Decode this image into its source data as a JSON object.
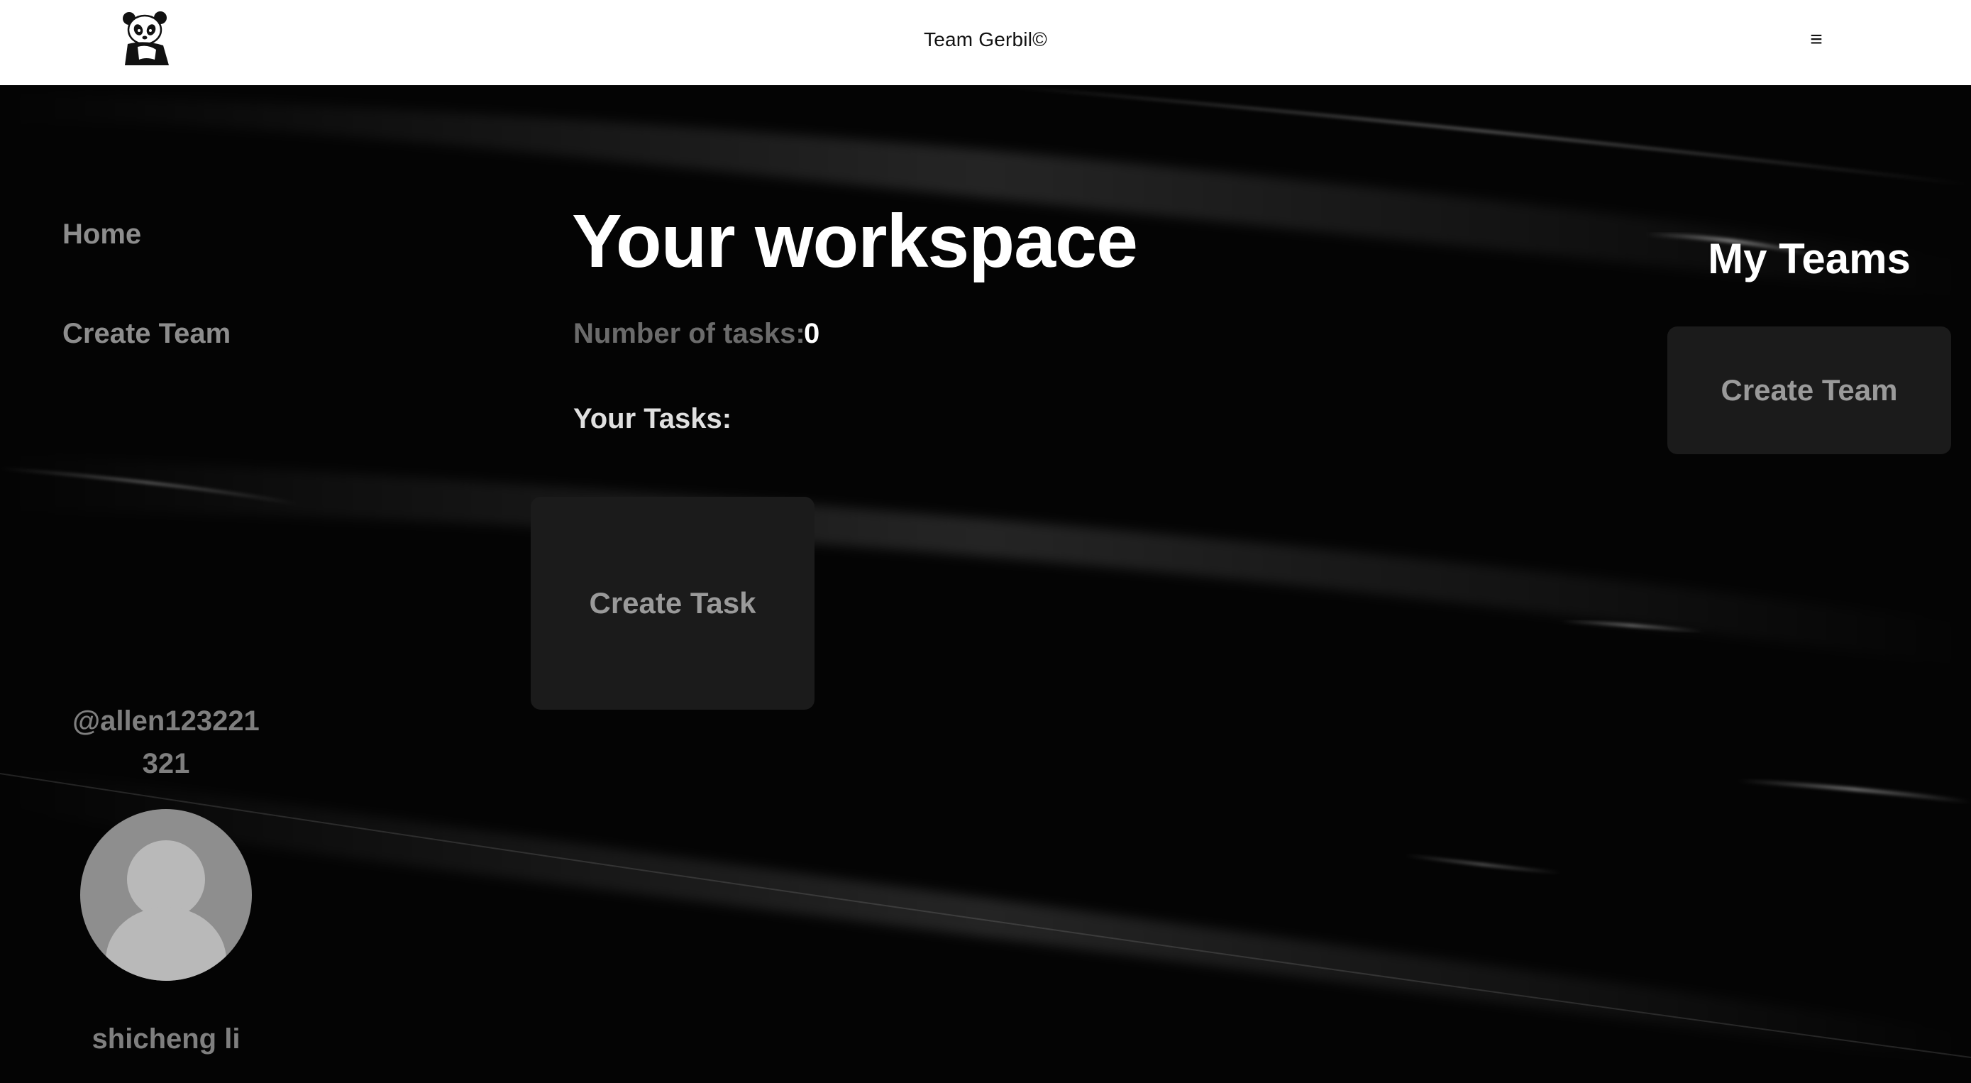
{
  "header": {
    "title": "Team Gerbil©",
    "logo_icon": "panda-logo-icon",
    "menu_icon": "≡"
  },
  "sidebar": {
    "items": [
      {
        "label": "Home"
      },
      {
        "label": "Create Team"
      }
    ]
  },
  "profile": {
    "username": "@allen123221321",
    "avatar_icon": "default-avatar-icon",
    "name": "shicheng li"
  },
  "main": {
    "title": "Your workspace",
    "task_count_label": "Number of tasks:",
    "task_count": "0",
    "tasks_heading": "Your Tasks:",
    "create_task_label": "Create Task"
  },
  "teams": {
    "heading": "My Teams",
    "create_team_label": "Create Team"
  },
  "colors": {
    "background": "#000000",
    "header_bg": "#ffffff",
    "card_bg": "#1b1b1b",
    "muted_text": "#8d8d8d",
    "primary_text": "#ffffff"
  }
}
